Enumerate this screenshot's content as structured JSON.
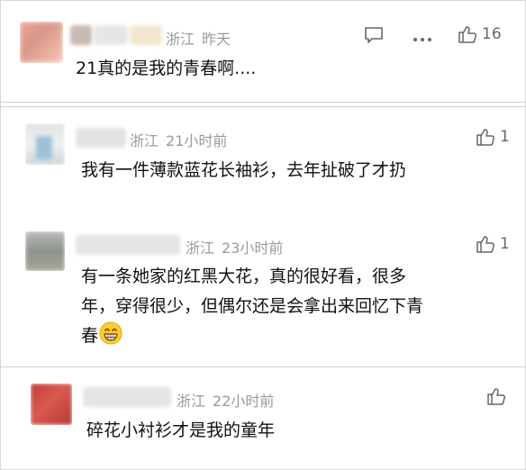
{
  "comments": [
    {
      "location": "浙江",
      "time": "昨天",
      "text_lines": [
        "21真的是我的青春啊...."
      ],
      "likes": "16"
    },
    {
      "location": "浙江",
      "time": "21小时前",
      "text_lines": [
        "我有一件薄款蓝花长袖衫，去年扯破了才扔"
      ],
      "likes": "1"
    },
    {
      "location": "浙江",
      "time": "23小时前",
      "text_lines": [
        "有一条她家的红黑大花，真的很好看，很多",
        "年，穿得很少，但偶尔还是会拿出来回忆下青",
        "春"
      ],
      "emoji": "grin-emoji",
      "likes": "1"
    },
    {
      "location": "浙江",
      "time": "22小时前",
      "text_lines": [
        "碎花小衬衫才是我的童年"
      ],
      "likes": ""
    }
  ],
  "icons": [
    "comment-icon",
    "more-icon",
    "thumbs-up-icon",
    "grin-emoji"
  ],
  "colors": {
    "meta_gray": "#9a9a9a",
    "text": "#111111",
    "separator": "#d0d0d0"
  }
}
